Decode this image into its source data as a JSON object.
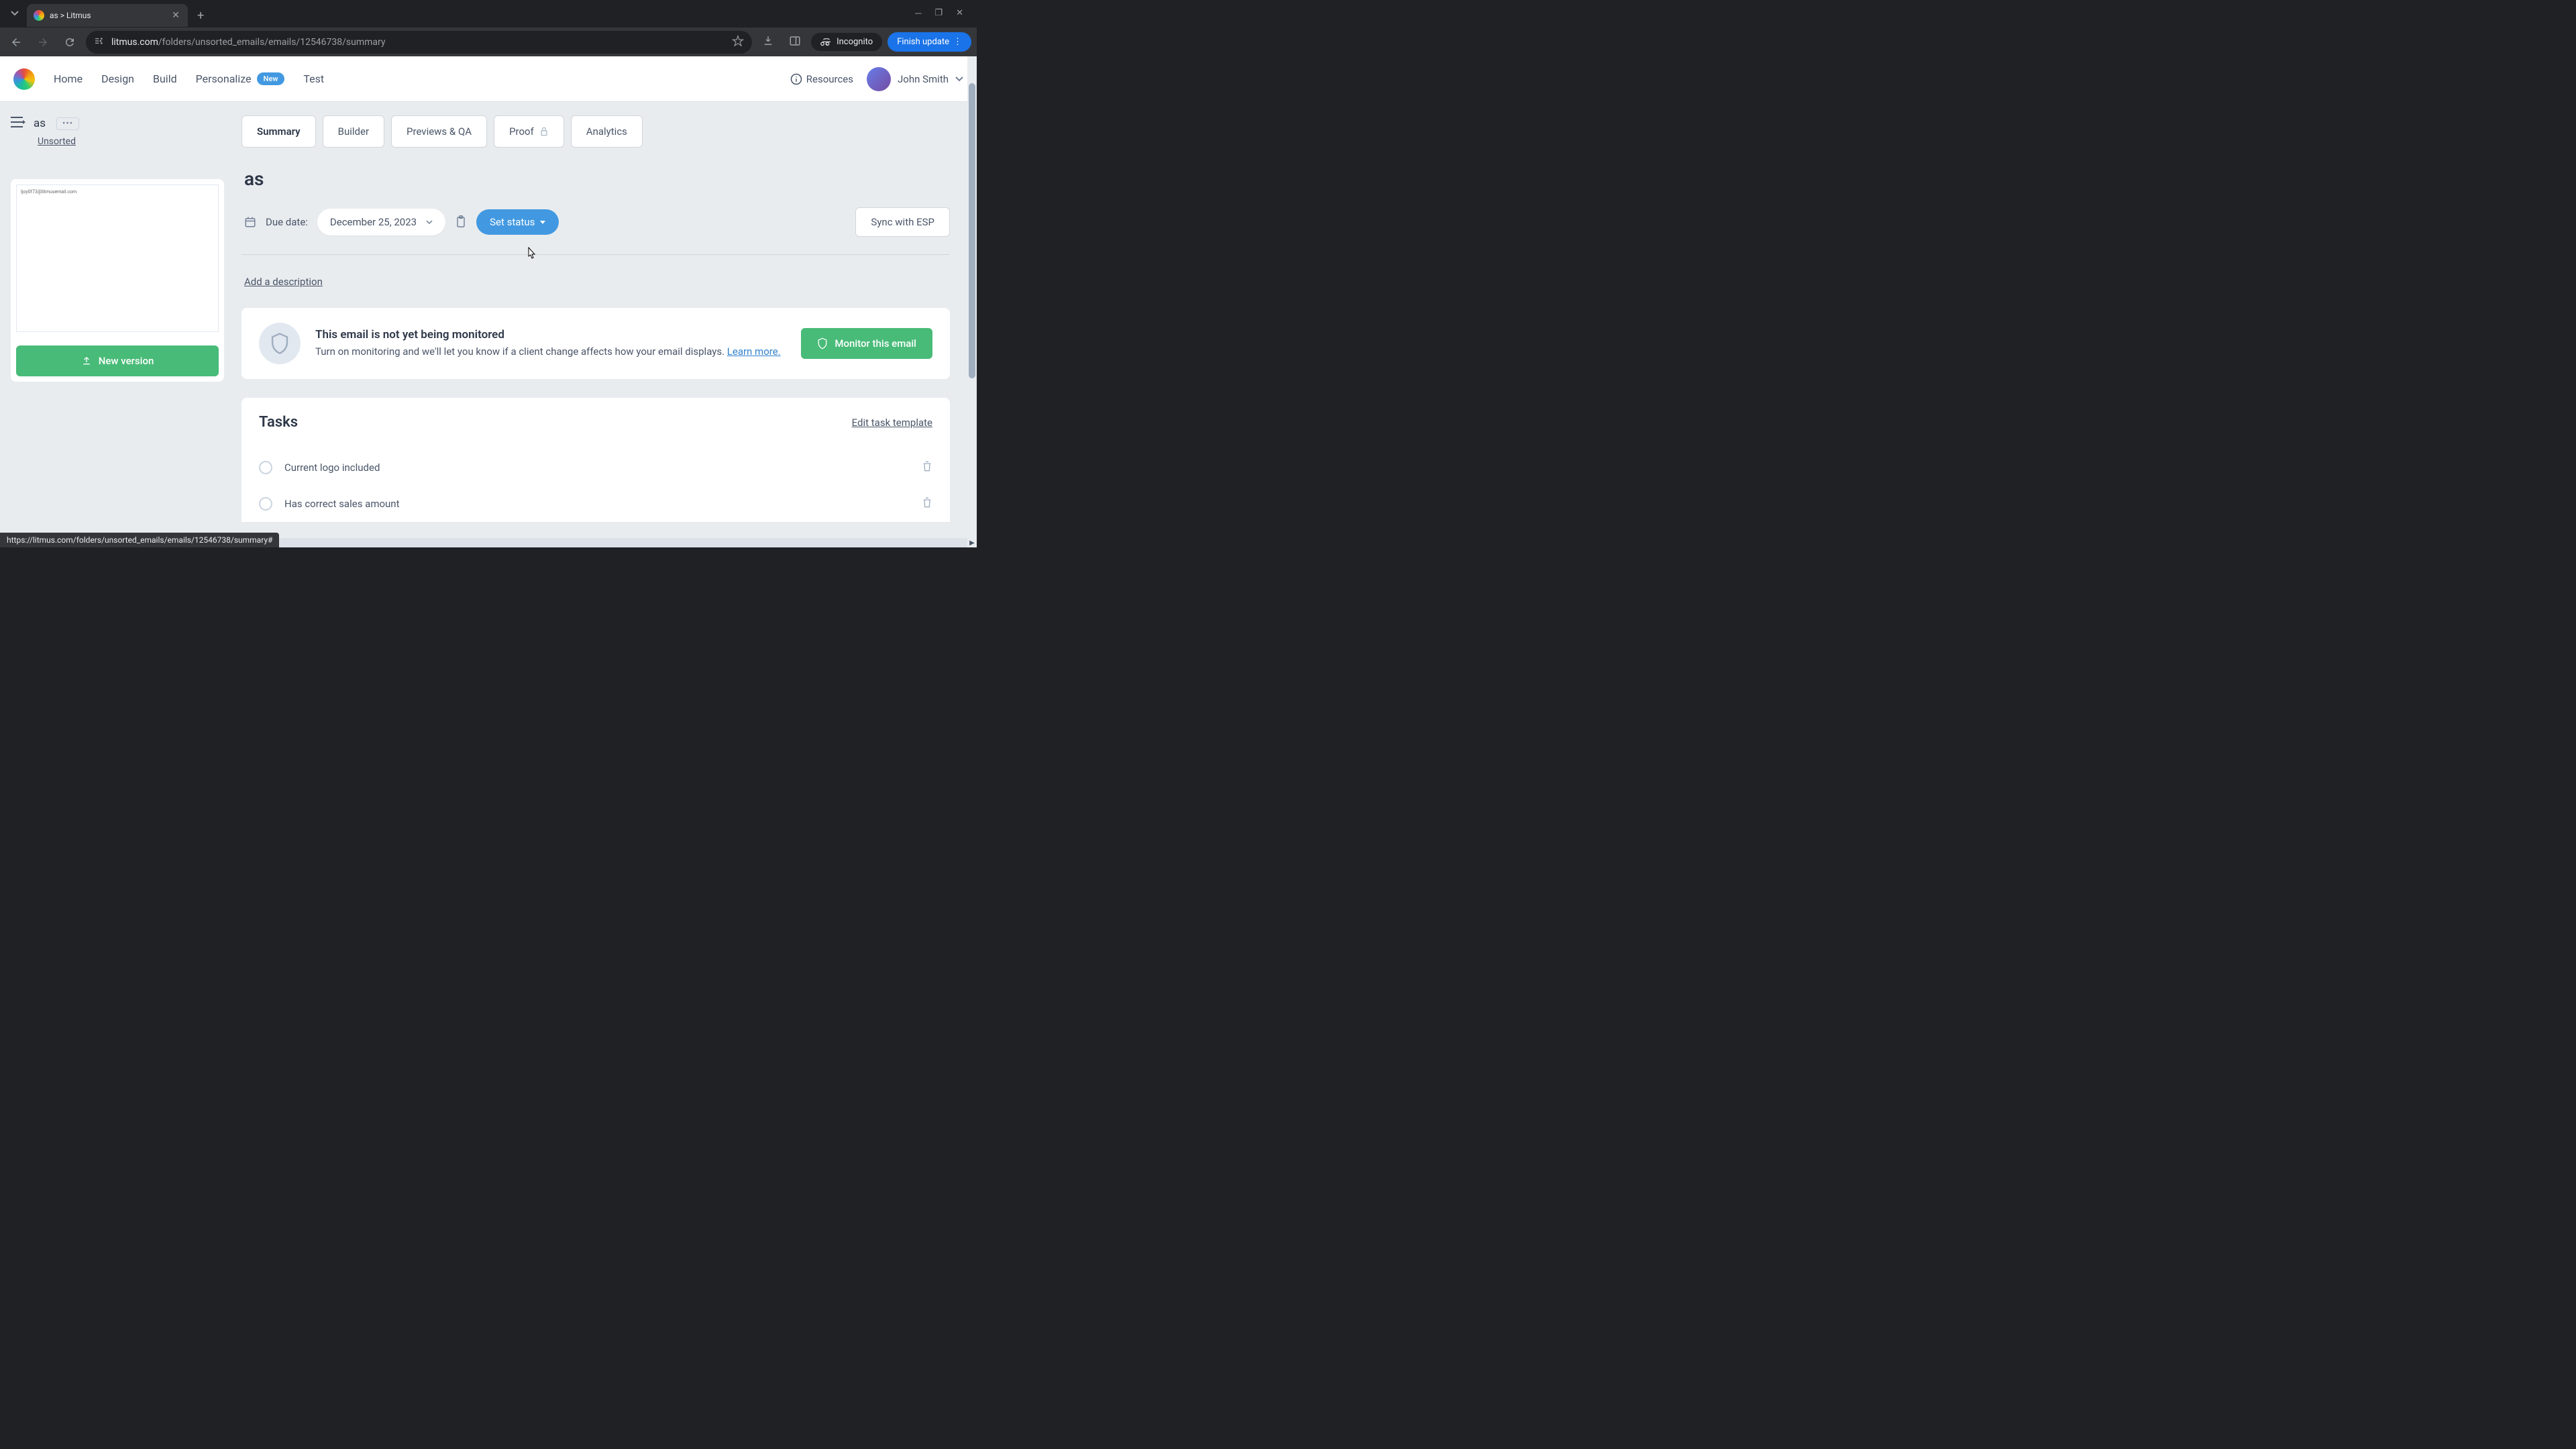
{
  "browser": {
    "tab_title": "as > Litmus",
    "url_domain": "litmus.com",
    "url_path": "/folders/unsorted_emails/emails/12546738/summary",
    "incognito_label": "Incognito",
    "finish_update_label": "Finish update",
    "status_url": "https://litmus.com/folders/unsorted_emails/emails/12546738/summary#"
  },
  "header": {
    "nav": {
      "home": "Home",
      "design": "Design",
      "build": "Build",
      "personalize": "Personalize",
      "new_badge": "New",
      "test": "Test"
    },
    "resources_label": "Resources",
    "user_name": "John Smith"
  },
  "sidebar": {
    "email_name": "as",
    "folder": "Unsorted",
    "preview_text": "ljoy0f73@litmusemail.com",
    "new_version_label": "New version"
  },
  "tabs": {
    "summary": "Summary",
    "builder": "Builder",
    "previews": "Previews & QA",
    "proof": "Proof",
    "analytics": "Analytics"
  },
  "main": {
    "title": "as",
    "due_date_label": "Due date:",
    "due_date_value": "December 25, 2023",
    "set_status_label": "Set status",
    "sync_label": "Sync with ESP",
    "add_description_label": "Add a description"
  },
  "monitor": {
    "title": "This email is not yet being monitored",
    "description": "Turn on monitoring and we'll let you know if a client change affects how your email displays. ",
    "learn_more": "Learn more.",
    "button_label": "Monitor this email"
  },
  "tasks": {
    "title": "Tasks",
    "edit_template_label": "Edit task template",
    "items": [
      {
        "label": "Current logo included"
      },
      {
        "label": "Has correct sales amount"
      }
    ]
  }
}
